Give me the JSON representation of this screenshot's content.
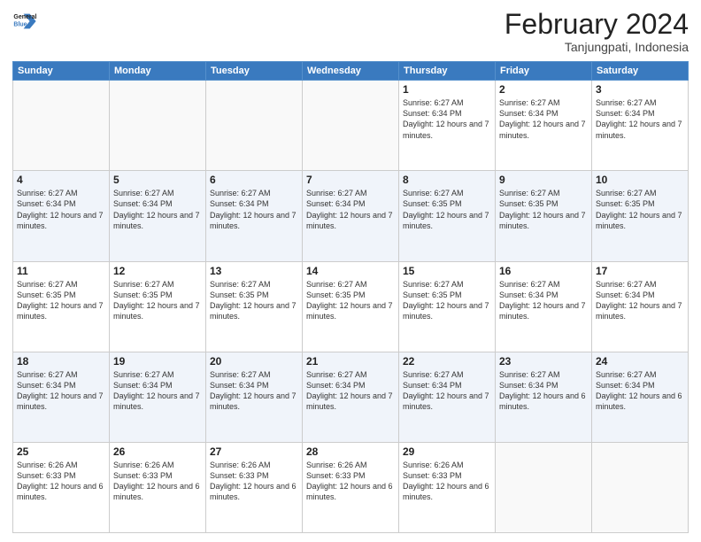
{
  "header": {
    "logo_line1": "General",
    "logo_line2": "Blue",
    "title": "February 2024",
    "subtitle": "Tanjungpati, Indonesia"
  },
  "weekdays": [
    "Sunday",
    "Monday",
    "Tuesday",
    "Wednesday",
    "Thursday",
    "Friday",
    "Saturday"
  ],
  "weeks": [
    [
      {
        "day": "",
        "empty": true
      },
      {
        "day": "",
        "empty": true
      },
      {
        "day": "",
        "empty": true
      },
      {
        "day": "",
        "empty": true
      },
      {
        "day": "1",
        "sunrise": "6:27 AM",
        "sunset": "6:34 PM",
        "daylight": "12 hours and 7 minutes."
      },
      {
        "day": "2",
        "sunrise": "6:27 AM",
        "sunset": "6:34 PM",
        "daylight": "12 hours and 7 minutes."
      },
      {
        "day": "3",
        "sunrise": "6:27 AM",
        "sunset": "6:34 PM",
        "daylight": "12 hours and 7 minutes."
      }
    ],
    [
      {
        "day": "4",
        "sunrise": "6:27 AM",
        "sunset": "6:34 PM",
        "daylight": "12 hours and 7 minutes."
      },
      {
        "day": "5",
        "sunrise": "6:27 AM",
        "sunset": "6:34 PM",
        "daylight": "12 hours and 7 minutes."
      },
      {
        "day": "6",
        "sunrise": "6:27 AM",
        "sunset": "6:34 PM",
        "daylight": "12 hours and 7 minutes."
      },
      {
        "day": "7",
        "sunrise": "6:27 AM",
        "sunset": "6:34 PM",
        "daylight": "12 hours and 7 minutes."
      },
      {
        "day": "8",
        "sunrise": "6:27 AM",
        "sunset": "6:35 PM",
        "daylight": "12 hours and 7 minutes."
      },
      {
        "day": "9",
        "sunrise": "6:27 AM",
        "sunset": "6:35 PM",
        "daylight": "12 hours and 7 minutes."
      },
      {
        "day": "10",
        "sunrise": "6:27 AM",
        "sunset": "6:35 PM",
        "daylight": "12 hours and 7 minutes."
      }
    ],
    [
      {
        "day": "11",
        "sunrise": "6:27 AM",
        "sunset": "6:35 PM",
        "daylight": "12 hours and 7 minutes."
      },
      {
        "day": "12",
        "sunrise": "6:27 AM",
        "sunset": "6:35 PM",
        "daylight": "12 hours and 7 minutes."
      },
      {
        "day": "13",
        "sunrise": "6:27 AM",
        "sunset": "6:35 PM",
        "daylight": "12 hours and 7 minutes."
      },
      {
        "day": "14",
        "sunrise": "6:27 AM",
        "sunset": "6:35 PM",
        "daylight": "12 hours and 7 minutes."
      },
      {
        "day": "15",
        "sunrise": "6:27 AM",
        "sunset": "6:35 PM",
        "daylight": "12 hours and 7 minutes."
      },
      {
        "day": "16",
        "sunrise": "6:27 AM",
        "sunset": "6:34 PM",
        "daylight": "12 hours and 7 minutes."
      },
      {
        "day": "17",
        "sunrise": "6:27 AM",
        "sunset": "6:34 PM",
        "daylight": "12 hours and 7 minutes."
      }
    ],
    [
      {
        "day": "18",
        "sunrise": "6:27 AM",
        "sunset": "6:34 PM",
        "daylight": "12 hours and 7 minutes."
      },
      {
        "day": "19",
        "sunrise": "6:27 AM",
        "sunset": "6:34 PM",
        "daylight": "12 hours and 7 minutes."
      },
      {
        "day": "20",
        "sunrise": "6:27 AM",
        "sunset": "6:34 PM",
        "daylight": "12 hours and 7 minutes."
      },
      {
        "day": "21",
        "sunrise": "6:27 AM",
        "sunset": "6:34 PM",
        "daylight": "12 hours and 7 minutes."
      },
      {
        "day": "22",
        "sunrise": "6:27 AM",
        "sunset": "6:34 PM",
        "daylight": "12 hours and 7 minutes."
      },
      {
        "day": "23",
        "sunrise": "6:27 AM",
        "sunset": "6:34 PM",
        "daylight": "12 hours and 6 minutes."
      },
      {
        "day": "24",
        "sunrise": "6:27 AM",
        "sunset": "6:34 PM",
        "daylight": "12 hours and 6 minutes."
      }
    ],
    [
      {
        "day": "25",
        "sunrise": "6:26 AM",
        "sunset": "6:33 PM",
        "daylight": "12 hours and 6 minutes."
      },
      {
        "day": "26",
        "sunrise": "6:26 AM",
        "sunset": "6:33 PM",
        "daylight": "12 hours and 6 minutes."
      },
      {
        "day": "27",
        "sunrise": "6:26 AM",
        "sunset": "6:33 PM",
        "daylight": "12 hours and 6 minutes."
      },
      {
        "day": "28",
        "sunrise": "6:26 AM",
        "sunset": "6:33 PM",
        "daylight": "12 hours and 6 minutes."
      },
      {
        "day": "29",
        "sunrise": "6:26 AM",
        "sunset": "6:33 PM",
        "daylight": "12 hours and 6 minutes."
      },
      {
        "day": "",
        "empty": true
      },
      {
        "day": "",
        "empty": true
      }
    ]
  ],
  "labels": {
    "sunrise": "Sunrise:",
    "sunset": "Sunset:",
    "daylight": "Daylight:"
  }
}
